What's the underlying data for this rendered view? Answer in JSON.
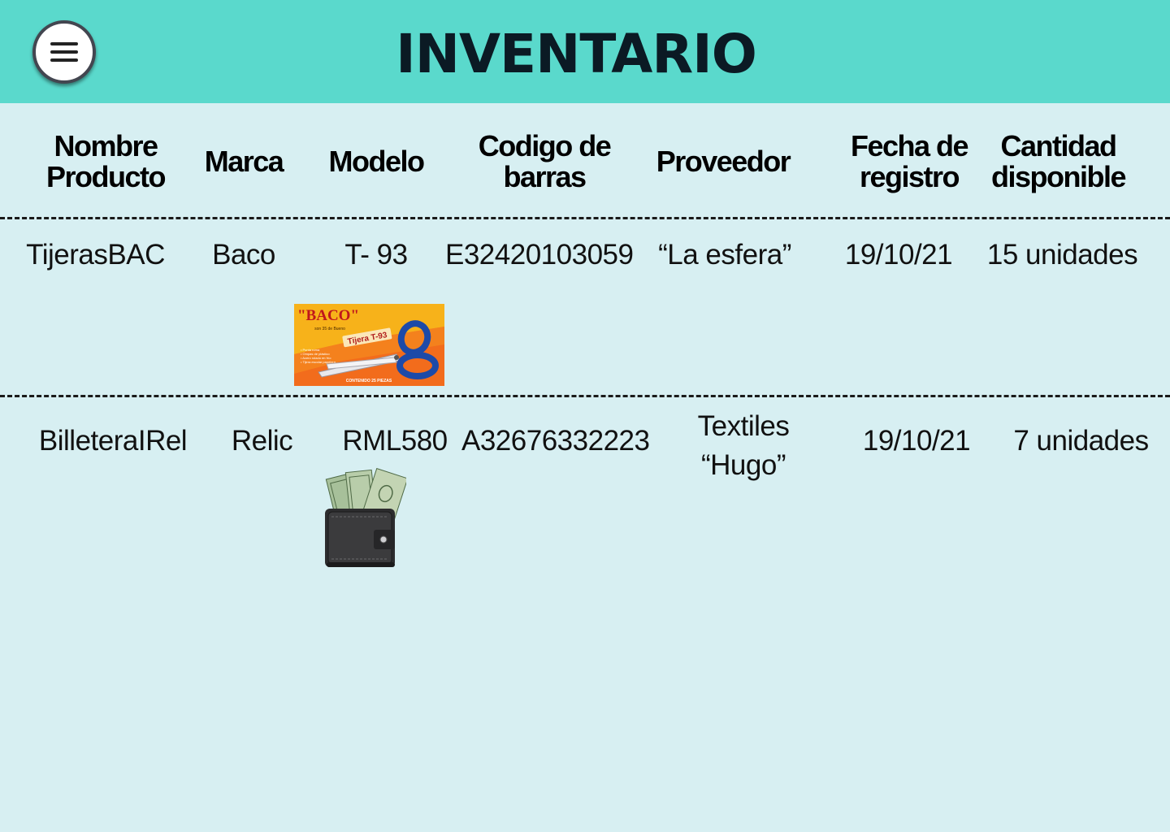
{
  "header": {
    "title": "INVENTARIO",
    "menu_icon": "hamburger-menu-icon"
  },
  "table": {
    "columns": [
      "Nombre\nProducto",
      "Marca",
      "Modelo",
      "Codigo de\nbarras",
      "Proveedor",
      "Fecha de\nregistro",
      "Cantidad\ndisponible"
    ],
    "rows": [
      {
        "nombre": "TijerasBAC",
        "marca": "Baco",
        "modelo": "T- 93",
        "codigo": "E32420103059",
        "proveedor": "“La esfera”",
        "fecha": "19/10/21",
        "cantidad": "15 unidades",
        "image": {
          "type": "scissors-box-image",
          "brand_text": "\"BACO\"",
          "subtitle": "son 35 de Bueno",
          "label": "Tijera T-93",
          "bullets": [
            "• Punta roma",
            "• Ompas de plástico",
            "• Acero rolado en frío",
            "• Tijera escolar papelera"
          ],
          "footer": "CONTENIDO 25 PIEZAS"
        }
      },
      {
        "nombre": "BilleteraIRel",
        "marca": "Relic",
        "modelo": "RML580",
        "codigo": "A32676332223",
        "proveedor": "Textiles\n“Hugo”",
        "fecha": "19/10/21",
        "cantidad": "7 unidades",
        "image": {
          "type": "wallet-with-bills-image"
        }
      }
    ]
  },
  "colors": {
    "header_bg": "#5ad9cc",
    "page_bg": "#d7eff2",
    "title": "#0b1a24",
    "box_orange": "#f26c1c",
    "box_yellow": "#f7b21a"
  }
}
